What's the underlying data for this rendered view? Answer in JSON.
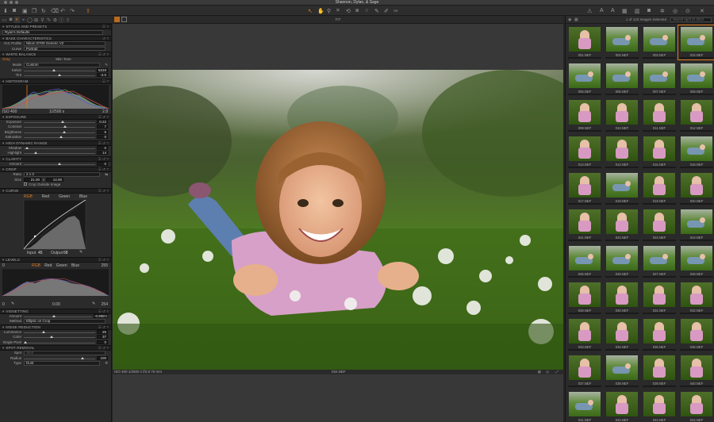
{
  "window": {
    "title": "Shannon, Dylan, & Sage"
  },
  "browser_head": {
    "label": "1 of 123 Images Selected",
    "search_placeholder": "Search April 21 2013"
  },
  "viewer": {
    "zoom_label": "FIT",
    "filename": "034.NEF",
    "exif": "ISO 400   1/2500 s   f/2.8   70 mm",
    "title_left": "ISO 400",
    "title_mid": "1/2500 s"
  },
  "tools_tabs": [
    "library",
    "capture",
    "color",
    "exposure",
    "lens",
    "composition",
    "details",
    "local",
    "adjust",
    "metadata",
    "output"
  ],
  "sections": {
    "styles": {
      "title": "STYLES AND PRESETS",
      "value": "Ryan's Defaults"
    },
    "base": {
      "title": "BASE CHARACTERISTICS",
      "icc_label": "ICC Profile",
      "icc_value": "Nikon D700 Generic V2",
      "curve_label": "Curve",
      "curve_value": "Portrait"
    },
    "white_balance": {
      "title": "WHITE BALANCE",
      "tab1": "Gray",
      "tab2": "Skin Tone",
      "mode_label": "Mode",
      "mode_value": "Custom",
      "kelvin_label": "Kelvin",
      "kelvin_value": "5319",
      "tint_label": "Tint",
      "tint_value": "-2.0"
    },
    "histogram": {
      "title": "HISTOGRAM",
      "iso": "ISO 400",
      "shutter": "1/2500 s",
      "aperture": "2.8"
    },
    "exposure": {
      "title": "EXPOSURE",
      "rows": [
        {
          "label": "Exposure",
          "value": "0.22",
          "pos": 0.52
        },
        {
          "label": "Contrast",
          "value": "7",
          "pos": 0.55
        },
        {
          "label": "Brightness",
          "value": "6",
          "pos": 0.54
        },
        {
          "label": "Saturation",
          "value": "0",
          "pos": 0.5
        }
      ]
    },
    "hdr": {
      "title": "HIGH DYNAMIC RANGE",
      "rows": [
        {
          "label": "Shadow",
          "value": "0",
          "pos": 0.02
        },
        {
          "label": "Highlight",
          "value": "14",
          "pos": 0.14
        }
      ]
    },
    "clarity": {
      "title": "CLARITY",
      "amount_label": "Amount",
      "amount_value": "0",
      "amount_pos": 0.5
    },
    "crop": {
      "title": "CROP",
      "ratio_label": "Ratio",
      "ratio_value": "2 x 3",
      "size_label": "Size",
      "size_w": "21.00",
      "size_h": "14.00",
      "outside_label": "Crop Outside Image"
    },
    "curve": {
      "title": "CURVE",
      "tabs": [
        "RGB",
        "Red",
        "Green",
        "Blue"
      ],
      "input_label": "Input",
      "input_value": "45",
      "output_label": "Output",
      "output_value": "68"
    },
    "levels": {
      "title": "LEVELS",
      "tabs": [
        "RGB",
        "Red",
        "Green",
        "Blue"
      ],
      "top_left": "0",
      "top_right": "255",
      "bottom_left": "0",
      "mid": "0.00",
      "bottom_right": "254"
    },
    "vignetting": {
      "title": "VIGNETTING",
      "amount_label": "Amount",
      "amount_value": "-0.90EV",
      "method_label": "Method",
      "method_value": "Elliptic on Crop"
    },
    "noise": {
      "title": "NOISE REDUCTION",
      "rows": [
        {
          "label": "Luminance",
          "value": "25",
          "pos": 0.25
        },
        {
          "label": "Color",
          "value": "37",
          "pos": 0.37
        },
        {
          "label": "Single Pixel",
          "value": "0",
          "pos": 0.0
        }
      ]
    },
    "spot": {
      "title": "SPOT REMOVAL",
      "spot_label": "Spot",
      "spot_value": "Spot",
      "radius_label": "Radius",
      "radius_value": "100",
      "type_label": "Type",
      "type_value": "Dust"
    }
  },
  "thumbnails": [
    {
      "name": "001.NEF",
      "kind": "p"
    },
    {
      "name": "002.NEF",
      "kind": "l"
    },
    {
      "name": "003.NEF",
      "kind": "l"
    },
    {
      "name": "034.NEF",
      "kind": "l",
      "selected": true
    },
    {
      "name": "005.NEF",
      "kind": "l"
    },
    {
      "name": "006.NEF",
      "kind": "l"
    },
    {
      "name": "007.NEF",
      "kind": "l"
    },
    {
      "name": "008.NEF",
      "kind": "l"
    },
    {
      "name": "009.NEF",
      "kind": "p"
    },
    {
      "name": "010.NEF",
      "kind": "p"
    },
    {
      "name": "011.NEF",
      "kind": "p"
    },
    {
      "name": "012.NEF",
      "kind": "p"
    },
    {
      "name": "013.NEF",
      "kind": "p"
    },
    {
      "name": "014.NEF",
      "kind": "p"
    },
    {
      "name": "015.NEF",
      "kind": "p"
    },
    {
      "name": "016.NEF",
      "kind": "l"
    },
    {
      "name": "017.NEF",
      "kind": "p"
    },
    {
      "name": "018.NEF",
      "kind": "l"
    },
    {
      "name": "019.NEF",
      "kind": "p"
    },
    {
      "name": "020.NEF",
      "kind": "p"
    },
    {
      "name": "021.NEF",
      "kind": "p"
    },
    {
      "name": "022.NEF",
      "kind": "p"
    },
    {
      "name": "023.NEF",
      "kind": "p"
    },
    {
      "name": "024.NEF",
      "kind": "l"
    },
    {
      "name": "025.NEF",
      "kind": "l"
    },
    {
      "name": "026.NEF",
      "kind": "l"
    },
    {
      "name": "027.NEF",
      "kind": "l"
    },
    {
      "name": "028.NEF",
      "kind": "l"
    },
    {
      "name": "029.NEF",
      "kind": "p"
    },
    {
      "name": "030.NEF",
      "kind": "p"
    },
    {
      "name": "031.NEF",
      "kind": "p"
    },
    {
      "name": "032.NEF",
      "kind": "p"
    },
    {
      "name": "033.NEF",
      "kind": "p"
    },
    {
      "name": "034.NEF",
      "kind": "p"
    },
    {
      "name": "035.NEF",
      "kind": "p"
    },
    {
      "name": "036.NEF",
      "kind": "p"
    },
    {
      "name": "037.NEF",
      "kind": "p"
    },
    {
      "name": "038.NEF",
      "kind": "l"
    },
    {
      "name": "039.NEF",
      "kind": "p"
    },
    {
      "name": "040.NEF",
      "kind": "p"
    },
    {
      "name": "041.NEF",
      "kind": "l"
    },
    {
      "name": "042.NEF",
      "kind": "p"
    },
    {
      "name": "043.NEF",
      "kind": "p"
    },
    {
      "name": "044.NEF",
      "kind": "p"
    }
  ],
  "colors": {
    "accent": "#e07a1a",
    "panel": "#2b2b2b",
    "viewer": "#383838"
  },
  "icons": {
    "toolbar_left": [
      "import-icon",
      "camera-icon",
      "film-icon",
      "copy-icon",
      "rotate-icon",
      "trash-icon",
      "undo-icon",
      "redo-icon",
      "share-icon"
    ],
    "toolbar_center": [
      "cursor-icon",
      "hand-icon",
      "zoom-icon",
      "crop-icon",
      "rotate-icon",
      "keystone-icon",
      "spot-icon",
      "wb-icon",
      "brush-icon",
      "eraser-icon",
      "gradient-icon"
    ],
    "toolbar_right": [
      "warning-icon",
      "a-icon",
      "a-icon",
      "grid-icon",
      "overlay-icon",
      "camera-icon",
      "settings-icon",
      "loupe-icon",
      "fullscreen-icon"
    ]
  }
}
